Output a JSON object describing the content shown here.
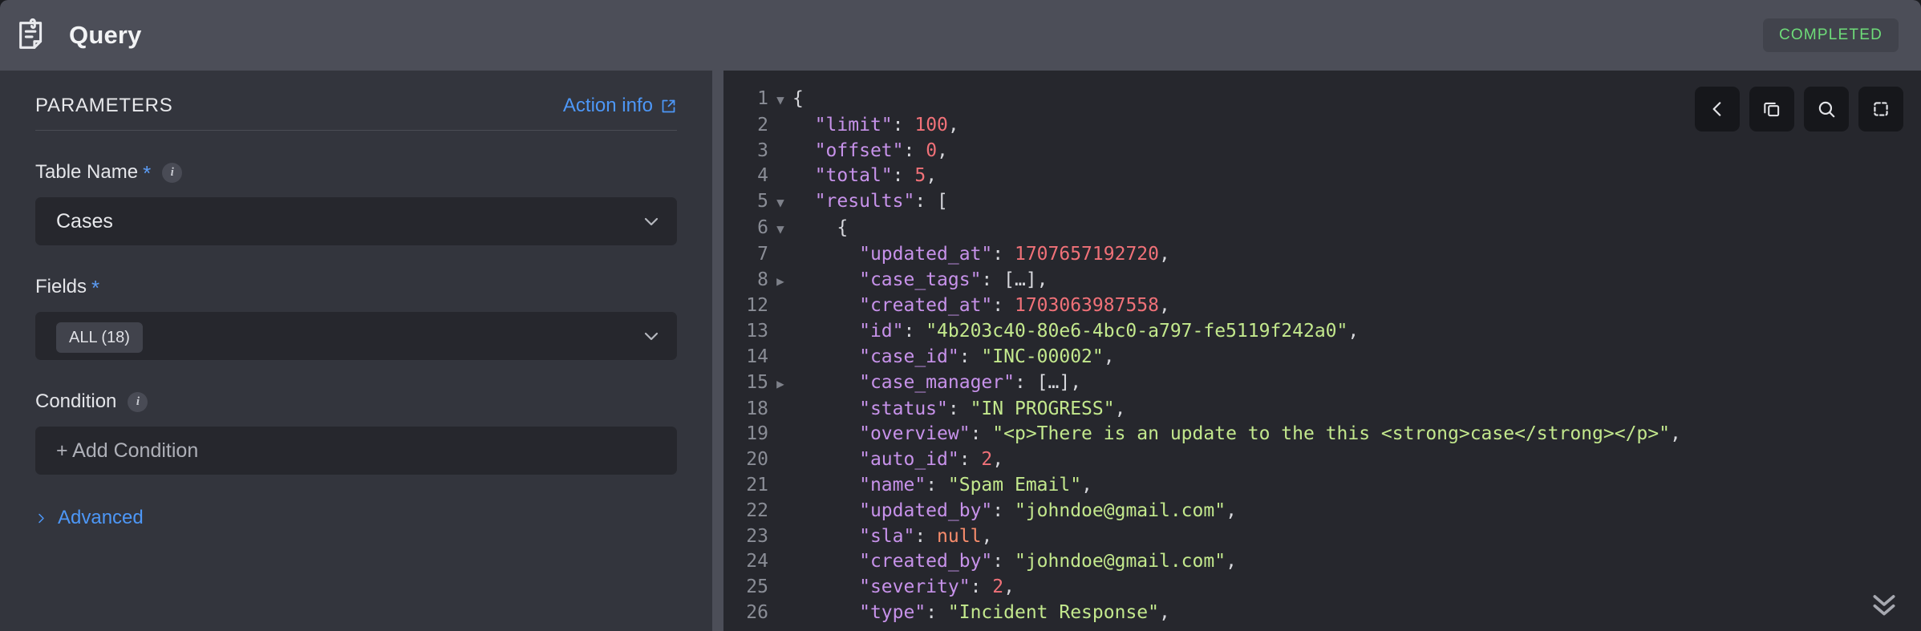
{
  "header": {
    "icon": "document-note-icon",
    "title": "Query",
    "status_badge": "COMPLETED",
    "status_color": "#6edd79",
    "background": "#4c4e58"
  },
  "parameters_panel": {
    "title": "PARAMETERS",
    "action_info_label": "Action info",
    "action_info_icon": "external-link-icon",
    "accent_color": "#4d97f7",
    "fields": [
      {
        "label": "Table Name",
        "required": true,
        "required_marker": "*",
        "has_info": true,
        "control": "select",
        "value": "Cases",
        "icon": "chevron-down-icon"
      },
      {
        "label": "Fields",
        "required": true,
        "required_marker": "*",
        "has_info": false,
        "control": "multiselect",
        "chip": "ALL (18)",
        "icon": "chevron-down-icon"
      },
      {
        "label": "Condition",
        "required": false,
        "required_marker": "",
        "has_info": true,
        "control": "button",
        "value": "+ Add Condition"
      }
    ],
    "advanced_label": "Advanced",
    "advanced_icon": "chevron-right-icon",
    "advanced_expanded": false
  },
  "json_viewer": {
    "toolbar": [
      {
        "name": "collapse-panel-button",
        "icon": "chevron-left-icon"
      },
      {
        "name": "copy-button",
        "icon": "copy-icon"
      },
      {
        "name": "search-button",
        "icon": "search-icon"
      },
      {
        "name": "fullscreen-button",
        "icon": "fullscreen-icon"
      }
    ],
    "scroll_down_icon": "chevrons-down-icon",
    "colors": {
      "background": "#26272d",
      "key": "#c792ea",
      "string": "#c3e88d",
      "number": "#f07178",
      "null": "#f78c6c",
      "punctuation": "#d6d7dc",
      "line_number": "#8a8d96"
    },
    "lines": [
      {
        "no": "1",
        "fold": "open",
        "indent": 0,
        "tokens": [
          {
            "t": "p",
            "v": "{"
          }
        ]
      },
      {
        "no": "2",
        "fold": "",
        "indent": 1,
        "tokens": [
          {
            "t": "k",
            "v": "\"limit\""
          },
          {
            "t": "p",
            "v": ": "
          },
          {
            "t": "n",
            "v": "100"
          },
          {
            "t": "p",
            "v": ","
          }
        ]
      },
      {
        "no": "3",
        "fold": "",
        "indent": 1,
        "tokens": [
          {
            "t": "k",
            "v": "\"offset\""
          },
          {
            "t": "p",
            "v": ": "
          },
          {
            "t": "n",
            "v": "0"
          },
          {
            "t": "p",
            "v": ","
          }
        ]
      },
      {
        "no": "4",
        "fold": "",
        "indent": 1,
        "tokens": [
          {
            "t": "k",
            "v": "\"total\""
          },
          {
            "t": "p",
            "v": ": "
          },
          {
            "t": "n",
            "v": "5"
          },
          {
            "t": "p",
            "v": ","
          }
        ]
      },
      {
        "no": "5",
        "fold": "open",
        "indent": 1,
        "tokens": [
          {
            "t": "k",
            "v": "\"results\""
          },
          {
            "t": "p",
            "v": ": ["
          }
        ]
      },
      {
        "no": "6",
        "fold": "open",
        "indent": 2,
        "tokens": [
          {
            "t": "p",
            "v": "{"
          }
        ]
      },
      {
        "no": "7",
        "fold": "",
        "indent": 3,
        "tokens": [
          {
            "t": "k",
            "v": "\"updated_at\""
          },
          {
            "t": "p",
            "v": ": "
          },
          {
            "t": "n",
            "v": "1707657192720"
          },
          {
            "t": "p",
            "v": ","
          }
        ]
      },
      {
        "no": "8",
        "fold": "closed",
        "indent": 3,
        "tokens": [
          {
            "t": "k",
            "v": "\"case_tags\""
          },
          {
            "t": "p",
            "v": ": […],"
          }
        ]
      },
      {
        "no": "12",
        "fold": "",
        "indent": 3,
        "tokens": [
          {
            "t": "k",
            "v": "\"created_at\""
          },
          {
            "t": "p",
            "v": ": "
          },
          {
            "t": "n",
            "v": "1703063987558"
          },
          {
            "t": "p",
            "v": ","
          }
        ]
      },
      {
        "no": "13",
        "fold": "",
        "indent": 3,
        "tokens": [
          {
            "t": "k",
            "v": "\"id\""
          },
          {
            "t": "p",
            "v": ": "
          },
          {
            "t": "s",
            "v": "\"4b203c40-80e6-4bc0-a797-fe5119f242a0\""
          },
          {
            "t": "p",
            "v": ","
          }
        ]
      },
      {
        "no": "14",
        "fold": "",
        "indent": 3,
        "tokens": [
          {
            "t": "k",
            "v": "\"case_id\""
          },
          {
            "t": "p",
            "v": ": "
          },
          {
            "t": "s",
            "v": "\"INC-00002\""
          },
          {
            "t": "p",
            "v": ","
          }
        ]
      },
      {
        "no": "15",
        "fold": "closed",
        "indent": 3,
        "tokens": [
          {
            "t": "k",
            "v": "\"case_manager\""
          },
          {
            "t": "p",
            "v": ": […],"
          }
        ]
      },
      {
        "no": "18",
        "fold": "",
        "indent": 3,
        "tokens": [
          {
            "t": "k",
            "v": "\"status\""
          },
          {
            "t": "p",
            "v": ": "
          },
          {
            "t": "s",
            "v": "\"IN PROGRESS\""
          },
          {
            "t": "p",
            "v": ","
          }
        ]
      },
      {
        "no": "19",
        "fold": "",
        "indent": 3,
        "tokens": [
          {
            "t": "k",
            "v": "\"overview\""
          },
          {
            "t": "p",
            "v": ": "
          },
          {
            "t": "s",
            "v": "\"<p>There is an update to the this <strong>case</strong></p>\""
          },
          {
            "t": "p",
            "v": ","
          }
        ]
      },
      {
        "no": "20",
        "fold": "",
        "indent": 3,
        "tokens": [
          {
            "t": "k",
            "v": "\"auto_id\""
          },
          {
            "t": "p",
            "v": ": "
          },
          {
            "t": "n",
            "v": "2"
          },
          {
            "t": "p",
            "v": ","
          }
        ]
      },
      {
        "no": "21",
        "fold": "",
        "indent": 3,
        "tokens": [
          {
            "t": "k",
            "v": "\"name\""
          },
          {
            "t": "p",
            "v": ": "
          },
          {
            "t": "s",
            "v": "\"Spam Email\""
          },
          {
            "t": "p",
            "v": ","
          }
        ]
      },
      {
        "no": "22",
        "fold": "",
        "indent": 3,
        "tokens": [
          {
            "t": "k",
            "v": "\"updated_by\""
          },
          {
            "t": "p",
            "v": ": "
          },
          {
            "t": "s",
            "v": "\"johndoe@gmail.com\""
          },
          {
            "t": "p",
            "v": ","
          }
        ]
      },
      {
        "no": "23",
        "fold": "",
        "indent": 3,
        "tokens": [
          {
            "t": "k",
            "v": "\"sla\""
          },
          {
            "t": "p",
            "v": ": "
          },
          {
            "t": "nl",
            "v": "null"
          },
          {
            "t": "p",
            "v": ","
          }
        ]
      },
      {
        "no": "24",
        "fold": "",
        "indent": 3,
        "tokens": [
          {
            "t": "k",
            "v": "\"created_by\""
          },
          {
            "t": "p",
            "v": ": "
          },
          {
            "t": "s",
            "v": "\"johndoe@gmail.com\""
          },
          {
            "t": "p",
            "v": ","
          }
        ]
      },
      {
        "no": "25",
        "fold": "",
        "indent": 3,
        "tokens": [
          {
            "t": "k",
            "v": "\"severity\""
          },
          {
            "t": "p",
            "v": ": "
          },
          {
            "t": "n",
            "v": "2"
          },
          {
            "t": "p",
            "v": ","
          }
        ]
      },
      {
        "no": "26",
        "fold": "",
        "indent": 3,
        "tokens": [
          {
            "t": "k",
            "v": "\"type\""
          },
          {
            "t": "p",
            "v": ": "
          },
          {
            "t": "s",
            "v": "\"Incident Response\""
          },
          {
            "t": "p",
            "v": ","
          }
        ]
      }
    ]
  }
}
